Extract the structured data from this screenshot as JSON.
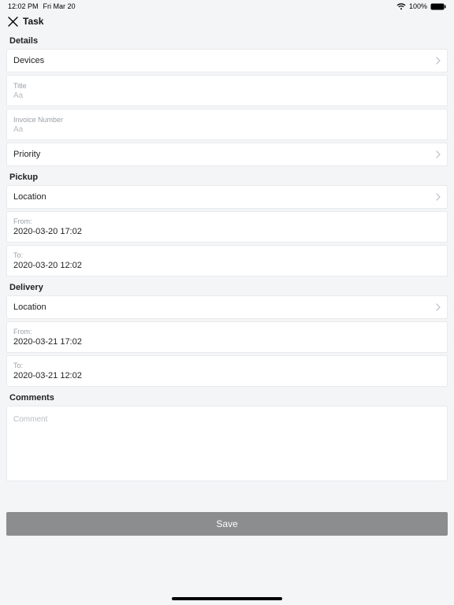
{
  "status": {
    "time": "12:02 PM",
    "date": "Fri Mar 20",
    "battery": "100%"
  },
  "nav": {
    "title": "Task"
  },
  "details": {
    "header": "Details",
    "devices": {
      "label": "Devices"
    },
    "title": {
      "label": "Title",
      "placeholder": "Aa"
    },
    "invoice": {
      "label": "Invoice Number",
      "placeholder": "Aa"
    },
    "priority": {
      "label": "Priority"
    }
  },
  "pickup": {
    "header": "Pickup",
    "location": {
      "label": "Location"
    },
    "from": {
      "label": "From:",
      "value": "2020-03-20 17:02"
    },
    "to": {
      "label": "To:",
      "value": "2020-03-20 12:02"
    }
  },
  "delivery": {
    "header": "Delivery",
    "location": {
      "label": "Location"
    },
    "from": {
      "label": "From:",
      "value": "2020-03-21 17:02"
    },
    "to": {
      "label": "To:",
      "value": "2020-03-21 12:02"
    }
  },
  "comments": {
    "header": "Comments",
    "placeholder": "Comment"
  },
  "actions": {
    "save": "Save"
  }
}
